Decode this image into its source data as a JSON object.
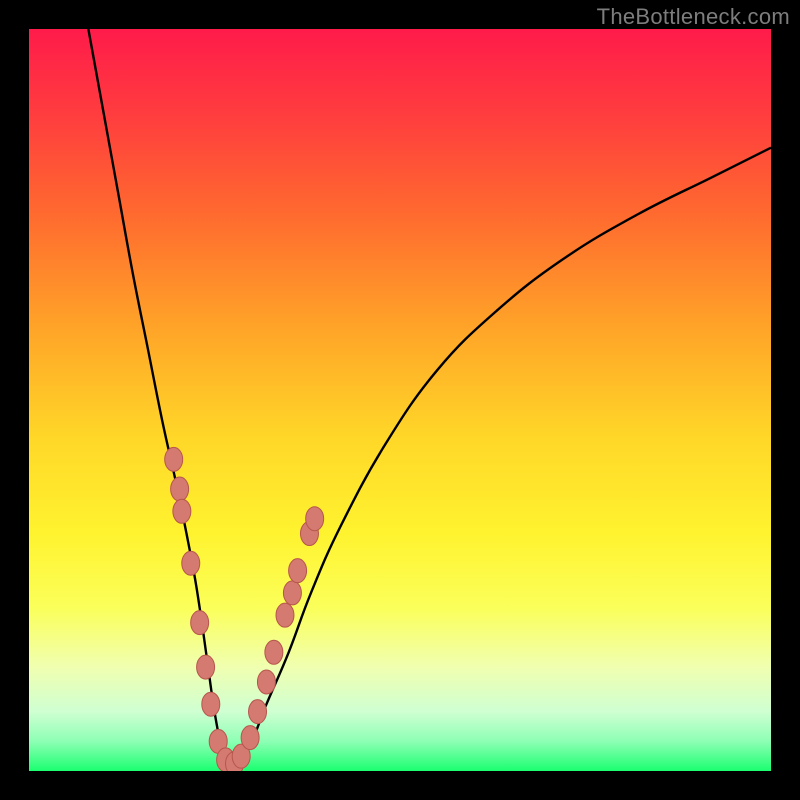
{
  "watermark": "TheBottleneck.com",
  "colors": {
    "background": "#000000",
    "watermark": "#7d7d7d",
    "curve": "#000000",
    "dot_fill": "#d47a71",
    "dot_stroke": "#b7564c"
  },
  "chart_data": {
    "type": "line",
    "title": "",
    "xlabel": "",
    "ylabel": "",
    "xlim": [
      0,
      100
    ],
    "ylim": [
      0,
      100
    ],
    "series": [
      {
        "name": "bottleneck-curve",
        "x": [
          8,
          10,
          12,
          14,
          16,
          18,
          20,
          22,
          23,
          24,
          25,
          26,
          27,
          28,
          30,
          32,
          35,
          38,
          42,
          48,
          55,
          63,
          72,
          82,
          92,
          100
        ],
        "y": [
          100,
          89,
          78,
          67,
          57,
          47,
          38,
          28,
          22,
          15,
          8,
          3,
          1,
          1,
          4,
          9,
          16,
          24,
          33,
          44,
          54,
          62,
          69,
          75,
          80,
          84
        ]
      }
    ],
    "annotations": {
      "dots": [
        {
          "x": 19.5,
          "y": 42
        },
        {
          "x": 20.3,
          "y": 38
        },
        {
          "x": 20.6,
          "y": 35
        },
        {
          "x": 21.8,
          "y": 28
        },
        {
          "x": 23.0,
          "y": 20
        },
        {
          "x": 23.8,
          "y": 14
        },
        {
          "x": 24.5,
          "y": 9
        },
        {
          "x": 25.5,
          "y": 4
        },
        {
          "x": 26.5,
          "y": 1.5
        },
        {
          "x": 27.7,
          "y": 1
        },
        {
          "x": 28.6,
          "y": 2
        },
        {
          "x": 29.8,
          "y": 4.5
        },
        {
          "x": 30.8,
          "y": 8
        },
        {
          "x": 32.0,
          "y": 12
        },
        {
          "x": 33.0,
          "y": 16
        },
        {
          "x": 34.5,
          "y": 21
        },
        {
          "x": 35.5,
          "y": 24
        },
        {
          "x": 36.2,
          "y": 27
        },
        {
          "x": 37.8,
          "y": 32
        },
        {
          "x": 38.5,
          "y": 34
        }
      ]
    }
  }
}
